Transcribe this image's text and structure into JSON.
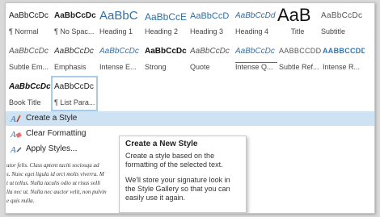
{
  "styles": [
    {
      "sample": "AaBbCcDc",
      "caption": "¶ Normal"
    },
    {
      "sample": "AaBbCcDc",
      "caption": "¶ No Spac..."
    },
    {
      "sample": "AaBbC",
      "caption": "Heading 1"
    },
    {
      "sample": "AaBbCcE",
      "caption": "Heading 2"
    },
    {
      "sample": "AaBbCcD",
      "caption": "Heading 3"
    },
    {
      "sample": "AaBbCcDd",
      "caption": "Heading 4"
    },
    {
      "sample": "AaB",
      "caption": "Title"
    },
    {
      "sample": "AaBbCcDc",
      "caption": "Subtitle"
    },
    {
      "sample": "AaBbCcDc",
      "caption": "Subtle Em..."
    },
    {
      "sample": "AaBbCcDc",
      "caption": "Emphasis"
    },
    {
      "sample": "AaBbCcDc",
      "caption": "Intense E..."
    },
    {
      "sample": "AaBbCcDc",
      "caption": "Strong"
    },
    {
      "sample": "AaBbCcDc",
      "caption": "Quote"
    },
    {
      "sample": "AaBbCcDc",
      "caption": "Intense Q..."
    },
    {
      "sample": "AABBCCDD",
      "caption": "Subtle Ref..."
    },
    {
      "sample": "AABBCCDD",
      "caption": "Intense R..."
    },
    {
      "sample": "AaBbCcDc",
      "caption": "Book Title"
    },
    {
      "sample": "AaBbCcDc",
      "caption": "¶ List Para..."
    }
  ],
  "menu": {
    "create_style": "Create a Style",
    "clear_formatting": "Clear Formatting",
    "apply_styles": "Apply Styles..."
  },
  "doc_text": [
    "utor felis. Class aptent taciti sociosqu ad",
    "s. Nunc eget ligula id orci molis viverra. M",
    "t ut tellus. Nulla iaculis odio ut risus solli",
    "lla nec ut. Nulla nec auctor velit, non pulvin",
    "e quis nulla."
  ],
  "tooltip": {
    "title": "Create a New Style",
    "p1": "Create a style based on the formatting of the selected text.",
    "p2": "We'll store your signature look in the Style Gallery so that you can easily use it again."
  },
  "colors": {
    "accent": "#2f6ea6",
    "hover": "#cde2f3"
  }
}
